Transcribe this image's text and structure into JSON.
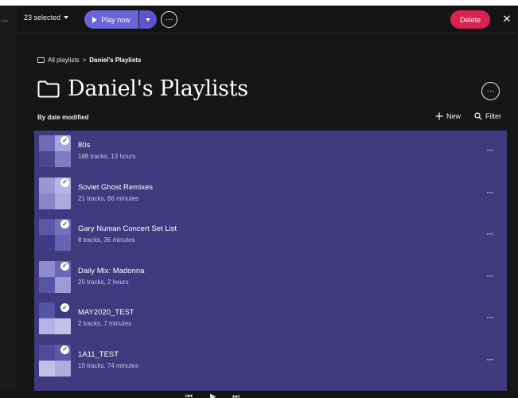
{
  "left_strip": {
    "menu_glyph": "..."
  },
  "topbar": {
    "selection_label": "23 selected",
    "play_label": "Play now",
    "delete_label": "Delete",
    "more_glyph": "···",
    "close_glyph": "✕"
  },
  "breadcrumb": {
    "root": "All playlists",
    "separator": ">",
    "current": "Daniel's Playlists"
  },
  "page": {
    "title": "Daniel's Playlists",
    "sort_label": "By date modified",
    "new_label": "New",
    "filter_label": "Filter"
  },
  "playlists": [
    {
      "title": "80s",
      "subtitle": "188 tracks, 13 hours",
      "selected": true,
      "colors": [
        "#6d6ab8",
        "#a5a3dc",
        "#4b4791",
        "#7f7cc4"
      ]
    },
    {
      "title": "Soviet Ghost Remixes",
      "subtitle": "21 tracks, 86 minutes",
      "selected": true,
      "colors": [
        "#9a98d4",
        "#b6b4e6",
        "#8886c8",
        "#aaa8de"
      ]
    },
    {
      "title": "Gary Numan Concert Set List",
      "subtitle": "8 tracks, 36 minutes",
      "selected": true,
      "colors": [
        "#5b58a8",
        "#7370bd",
        "#3f3c86",
        "#6663b2"
      ]
    },
    {
      "title": "Daily Mix: Madonna",
      "subtitle": "25 tracks, 2 hours",
      "selected": true,
      "colors": [
        "#8e8bcf",
        "#6a67b7",
        "#5755a6",
        "#9d9ad8"
      ]
    },
    {
      "title": "MAY2020_TEST",
      "subtitle": "2 tracks, 7 minutes",
      "selected": true,
      "colors": [
        "#5654a4",
        "#3d3a82",
        "#b5b3e4",
        "#c4c2ea"
      ]
    },
    {
      "title": "1A11_TEST",
      "subtitle": "10 tracks, 74 minutes",
      "selected": true,
      "colors": [
        "#4e4b9c",
        "#5c59a9",
        "#c2c0e8",
        "#afaddf"
      ]
    }
  ],
  "row_more_glyph": "···",
  "bottom": {
    "prev_glyph": "⏮",
    "play_glyph": "▶",
    "next_glyph": "⏭"
  },
  "colors": {
    "accent": "#6a64d8",
    "delete": "#d6234f",
    "list_background": "#3e3a7d",
    "app_background": "#161616"
  }
}
